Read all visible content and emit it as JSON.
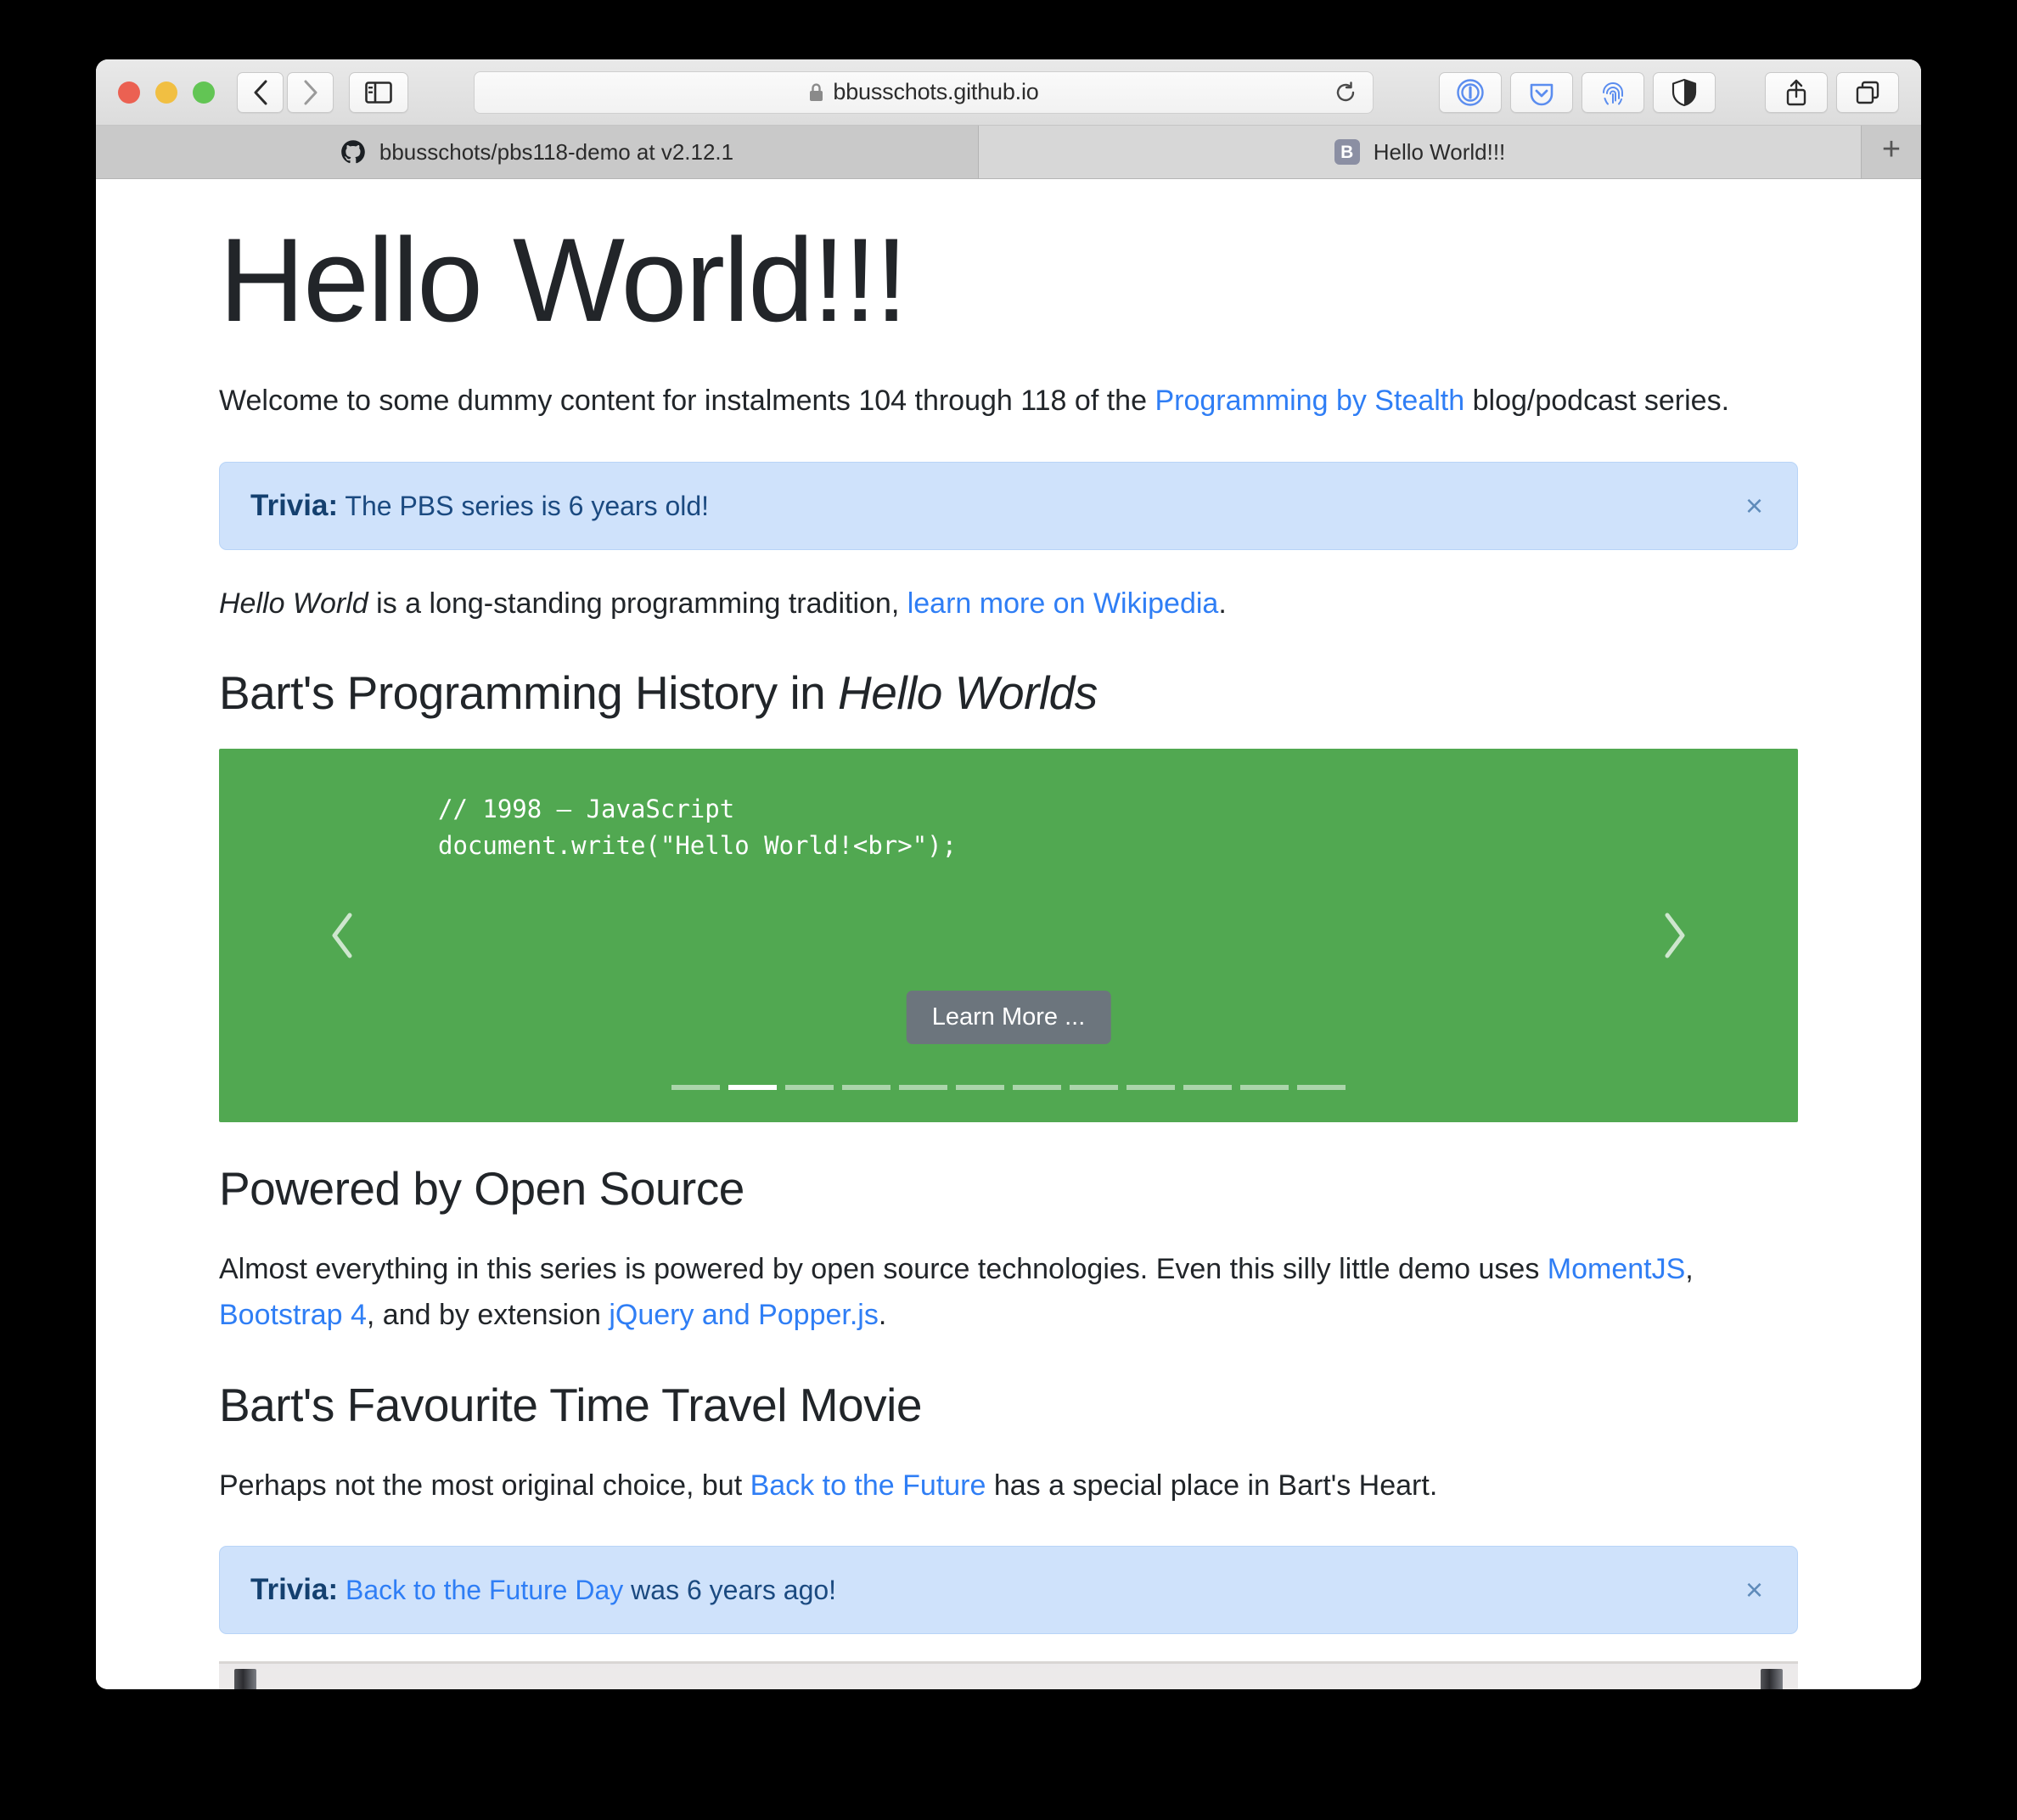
{
  "browser": {
    "traffic_lights": [
      "close",
      "minimize",
      "maximize"
    ],
    "nav": {
      "back_label": "Back",
      "forward_label": "Forward"
    },
    "sidebar_label": "Show Sidebar",
    "url": "bbusschots.github.io",
    "reload_label": "Reload",
    "extensions": [
      "1password-icon",
      "pocket-icon",
      "fingerprint-icon",
      "privacy-shield-icon"
    ],
    "share_label": "Share",
    "tabs_overview_label": "Show Tab Overview",
    "new_tab_label": "+",
    "tabs": [
      {
        "favicon": "github-icon",
        "title": "bbusschots/pbs118-demo at v2.12.1",
        "active": false
      },
      {
        "favicon": "b-favicon",
        "favicon_letter": "B",
        "title": "Hello World!!!",
        "active": true
      }
    ]
  },
  "page": {
    "title": "Hello World!!!",
    "intro": {
      "before_link": "Welcome to some dummy content for instalments 104 through 118 of the ",
      "link": "Programming by Stealth",
      "after_link": " blog/podcast series."
    },
    "alert_trivia_1": {
      "label": "Trivia:",
      "text": "The PBS series is 6 years old!",
      "close": "×"
    },
    "tradition": {
      "em": "Hello World",
      "middle": " is a long-standing programming tradition, ",
      "link": "learn more on Wikipedia",
      "after": "."
    },
    "history_heading": {
      "plain": "Bart's Programming History in ",
      "em": "Hello Worlds"
    },
    "carousel": {
      "code_line_1": "// 1998 — JavaScript",
      "code_line_2": "document.write(\"Hello World!<br>\");",
      "prev_label": "Previous",
      "next_label": "Next",
      "learn_more_label": "Learn More ...",
      "slide_count": 12,
      "active_slide": 2,
      "background_color": "#51a851"
    },
    "open_source_heading": "Powered by Open Source",
    "open_source_para": {
      "part1": "Almost everything in this series is powered by open source technologies. Even this silly little demo uses ",
      "link1": "MomentJS",
      "sep1": ", ",
      "link2": "Bootstrap 4",
      "sep2": ", and by extension ",
      "link3": "jQuery and Popper.js",
      "end": "."
    },
    "movie_heading": "Bart's Favourite Time Travel Movie",
    "movie_para": {
      "part1": "Perhaps not the most original choice, but ",
      "link": "Back to the Future",
      "part2": " has a special place in Bart's Heart."
    },
    "alert_trivia_2": {
      "label": "Trivia:",
      "link": "Back to the Future Day",
      "text": " was 6 years ago!",
      "close": "×"
    }
  },
  "colors": {
    "link": "#2f7ef5",
    "alert_bg": "#cfe2fb",
    "alert_text": "#1b4a80",
    "carousel_green": "#51a851",
    "button_gray": "#6c757d"
  }
}
